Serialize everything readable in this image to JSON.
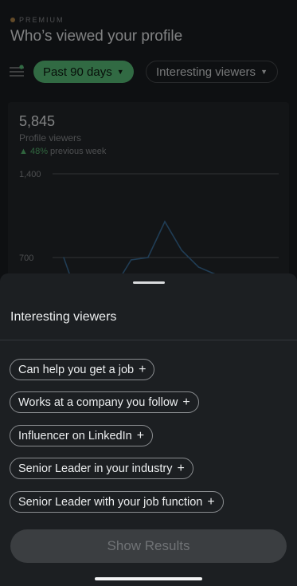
{
  "header": {
    "premium_label": "PREMIUM",
    "title": "Who’s viewed your profile"
  },
  "filters": {
    "filter_icon": "sliders-icon",
    "time_range": "Past 90 days",
    "viewer_type": "Interesting viewers"
  },
  "stats": {
    "views": "5,845",
    "views_label": "Profile viewers",
    "trend_percent": "48%",
    "trend_suffix": "previous week"
  },
  "chart_data": {
    "type": "line",
    "yticks": [
      "1,400",
      "700"
    ],
    "ylim": [
      0,
      1400
    ],
    "grid": true,
    "series": [
      {
        "values": [
          700,
          300,
          180,
          450,
          680,
          700,
          1000,
          760,
          620,
          560,
          450,
          380,
          460
        ]
      }
    ]
  },
  "sheet": {
    "title": "Interesting viewers",
    "options": [
      "Can help you get a job",
      "Works at a company you follow",
      "Influencer on LinkedIn",
      "Senior Leader in your industry",
      "Senior Leader with your job function"
    ],
    "plus_glyph": "+",
    "submit_label": "Show Results"
  },
  "colors": {
    "accent_green": "#5ac27a",
    "sheet_bg": "#1c1f22",
    "disabled_button": "#3b3e41"
  }
}
